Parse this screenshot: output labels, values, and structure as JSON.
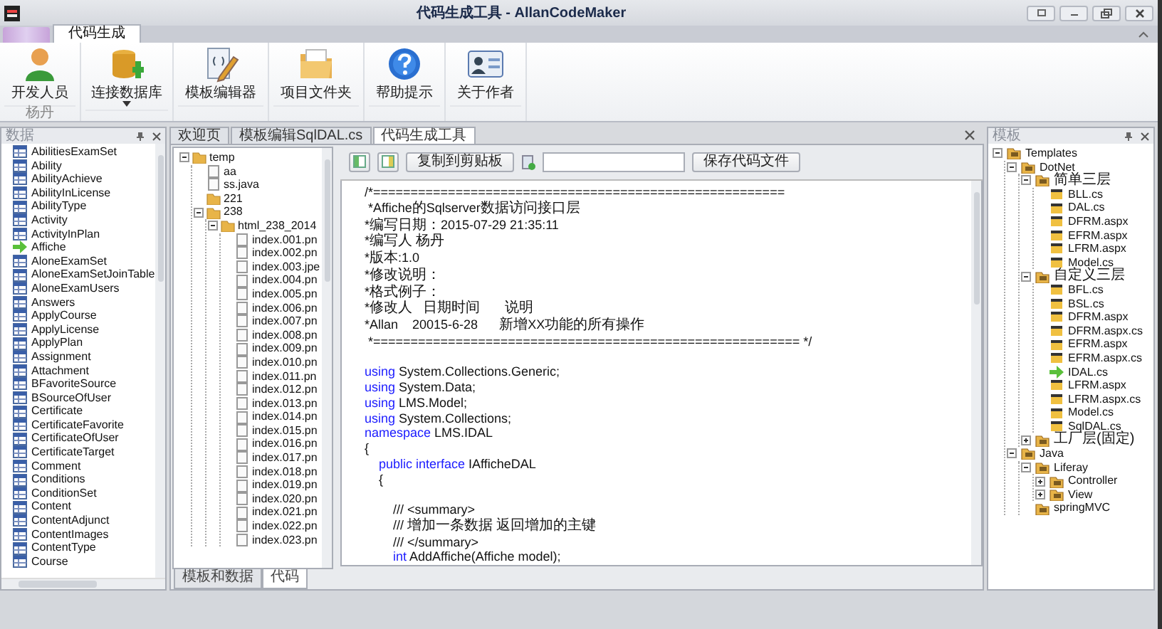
{
  "window": {
    "title": "代码生成工具 - AllanCodeMaker"
  },
  "ribbon": {
    "tabs": [
      {
        "label": "代码生成",
        "selected": true
      }
    ],
    "groups": [
      {
        "label": "杨丹",
        "buttons": [
          {
            "label": "开发人员",
            "dropdown": false
          }
        ]
      },
      {
        "buttons": [
          {
            "label": "连接数据库",
            "dropdown": true
          }
        ]
      },
      {
        "buttons": [
          {
            "label": "模板编辑器",
            "dropdown": false
          }
        ]
      },
      {
        "buttons": [
          {
            "label": "项目文件夹",
            "dropdown": false
          }
        ]
      },
      {
        "buttons": [
          {
            "label": "帮助提示",
            "dropdown": false
          }
        ]
      },
      {
        "buttons": [
          {
            "label": "关于作者",
            "dropdown": false
          }
        ]
      }
    ]
  },
  "data_panel": {
    "title": "数据",
    "items": [
      {
        "label": "AbilitiesExamSet",
        "kind": "table"
      },
      {
        "label": "Ability",
        "kind": "table"
      },
      {
        "label": "AbilityAchieve",
        "kind": "table"
      },
      {
        "label": "AbilityInLicense",
        "kind": "table"
      },
      {
        "label": "AbilityType",
        "kind": "table"
      },
      {
        "label": "Activity",
        "kind": "table"
      },
      {
        "label": "ActivityInPlan",
        "kind": "table"
      },
      {
        "label": "Affiche",
        "kind": "current"
      },
      {
        "label": "AloneExamSet",
        "kind": "table"
      },
      {
        "label": "AloneExamSetJoinTable",
        "kind": "table"
      },
      {
        "label": "AloneExamUsers",
        "kind": "table"
      },
      {
        "label": "Answers",
        "kind": "table"
      },
      {
        "label": "ApplyCourse",
        "kind": "table"
      },
      {
        "label": "ApplyLicense",
        "kind": "table"
      },
      {
        "label": "ApplyPlan",
        "kind": "table"
      },
      {
        "label": "Assignment",
        "kind": "table"
      },
      {
        "label": "Attachment",
        "kind": "table"
      },
      {
        "label": "BFavoriteSource",
        "kind": "table"
      },
      {
        "label": "BSourceOfUser",
        "kind": "table"
      },
      {
        "label": "Certificate",
        "kind": "table"
      },
      {
        "label": "CertificateFavorite",
        "kind": "table"
      },
      {
        "label": "CertificateOfUser",
        "kind": "table"
      },
      {
        "label": "CertificateTarget",
        "kind": "table"
      },
      {
        "label": "Comment",
        "kind": "table"
      },
      {
        "label": "Conditions",
        "kind": "table"
      },
      {
        "label": "ConditionSet",
        "kind": "table"
      },
      {
        "label": "Content",
        "kind": "table"
      },
      {
        "label": "ContentAdjunct",
        "kind": "table"
      },
      {
        "label": "ContentImages",
        "kind": "table"
      },
      {
        "label": "ContentType",
        "kind": "table"
      },
      {
        "label": "Course",
        "kind": "table"
      }
    ]
  },
  "documents": {
    "tabs": [
      {
        "label": "欢迎页",
        "selected": false
      },
      {
        "label": "模板编辑SqlDAL.cs",
        "selected": false
      },
      {
        "label": "代码生成工具",
        "selected": true
      }
    ]
  },
  "file_tree": {
    "nodes": [
      {
        "label": "temp",
        "kind": "folder",
        "expanded": true,
        "children": [
          {
            "label": "aa",
            "kind": "file"
          },
          {
            "label": "ss.java",
            "kind": "file"
          },
          {
            "label": "221",
            "kind": "folder"
          },
          {
            "label": "238",
            "kind": "folder",
            "expanded": true,
            "children": [
              {
                "label": "html_238_2014",
                "kind": "folder",
                "expanded": true,
                "children": [
                  {
                    "label": "index.001.pn",
                    "kind": "file"
                  },
                  {
                    "label": "index.002.pn",
                    "kind": "file"
                  },
                  {
                    "label": "index.003.jpe",
                    "kind": "file"
                  },
                  {
                    "label": "index.004.pn",
                    "kind": "file"
                  },
                  {
                    "label": "index.005.pn",
                    "kind": "file"
                  },
                  {
                    "label": "index.006.pn",
                    "kind": "file"
                  },
                  {
                    "label": "index.007.pn",
                    "kind": "file"
                  },
                  {
                    "label": "index.008.pn",
                    "kind": "file"
                  },
                  {
                    "label": "index.009.pn",
                    "kind": "file"
                  },
                  {
                    "label": "index.010.pn",
                    "kind": "file"
                  },
                  {
                    "label": "index.011.pn",
                    "kind": "file"
                  },
                  {
                    "label": "index.012.pn",
                    "kind": "file"
                  },
                  {
                    "label": "index.013.pn",
                    "kind": "file"
                  },
                  {
                    "label": "index.014.pn",
                    "kind": "file"
                  },
                  {
                    "label": "index.015.pn",
                    "kind": "file"
                  },
                  {
                    "label": "index.016.pn",
                    "kind": "file"
                  },
                  {
                    "label": "index.017.pn",
                    "kind": "file"
                  },
                  {
                    "label": "index.018.pn",
                    "kind": "file"
                  },
                  {
                    "label": "index.019.pn",
                    "kind": "file"
                  },
                  {
                    "label": "index.020.pn",
                    "kind": "file"
                  },
                  {
                    "label": "index.021.pn",
                    "kind": "file"
                  },
                  {
                    "label": "index.022.pn",
                    "kind": "file"
                  },
                  {
                    "label": "index.023.pn",
                    "kind": "file"
                  }
                ]
              }
            ]
          }
        ]
      }
    ],
    "tabs": [
      {
        "label": "模板和数据",
        "selected": false
      },
      {
        "label": "代码",
        "selected": true
      }
    ]
  },
  "code_toolbar": {
    "copy_button": "复制到剪贴板",
    "save_button": "保存代码文件"
  },
  "code": {
    "lines": [
      {
        "segments": [
          {
            "text": "/*=======================================================",
            "kind": "plain"
          }
        ]
      },
      {
        "segments": [
          {
            "text": " *Affiche的Sqlserver数据访问接口层",
            "kind": "plain"
          }
        ]
      },
      {
        "segments": [
          {
            "text": "*编写日期：2015-07-29 21:35:11",
            "kind": "plain"
          }
        ]
      },
      {
        "segments": [
          {
            "text": "*编写人 杨丹",
            "kind": "plain"
          }
        ]
      },
      {
        "segments": [
          {
            "text": "*版本:1.0",
            "kind": "plain"
          }
        ]
      },
      {
        "segments": [
          {
            "text": "*修改说明：",
            "kind": "plain"
          }
        ]
      },
      {
        "segments": [
          {
            "text": "*格式例子：",
            "kind": "plain"
          }
        ]
      },
      {
        "segments": [
          {
            "text": "*修改人   日期时间       说明",
            "kind": "plain"
          }
        ]
      },
      {
        "segments": [
          {
            "text": "*Allan    20015-6-28      新增XX功能的所有操作",
            "kind": "plain"
          }
        ]
      },
      {
        "segments": [
          {
            "text": " *========================================================= */",
            "kind": "plain"
          }
        ]
      },
      {
        "kind": "blank"
      },
      {
        "segments": [
          {
            "text": "using",
            "kind": "keyword"
          },
          {
            "text": " System.Collections.Generic;",
            "kind": "plain"
          }
        ]
      },
      {
        "segments": [
          {
            "text": "using",
            "kind": "keyword"
          },
          {
            "text": " System.Data;",
            "kind": "plain"
          }
        ]
      },
      {
        "segments": [
          {
            "text": "using",
            "kind": "keyword"
          },
          {
            "text": " LMS.Model;",
            "kind": "plain"
          }
        ]
      },
      {
        "segments": [
          {
            "text": "using",
            "kind": "keyword"
          },
          {
            "text": " System.Collections;",
            "kind": "plain"
          }
        ]
      },
      {
        "segments": [
          {
            "text": "namespace",
            "kind": "keyword"
          },
          {
            "text": " LMS.IDAL",
            "kind": "plain"
          }
        ]
      },
      {
        "segments": [
          {
            "text": "{",
            "kind": "plain"
          }
        ]
      },
      {
        "segments": [
          {
            "text": "    public interface",
            "kind": "keyword"
          },
          {
            "text": " IAfficheDAL",
            "kind": "plain"
          }
        ]
      },
      {
        "segments": [
          {
            "text": "    {",
            "kind": "plain"
          }
        ]
      },
      {
        "kind": "blank"
      },
      {
        "segments": [
          {
            "text": "        /// <summary>",
            "kind": "plain"
          }
        ]
      },
      {
        "segments": [
          {
            "text": "        /// 增加一条数据 返回增加的主键",
            "kind": "plain"
          }
        ]
      },
      {
        "segments": [
          {
            "text": "        /// </summary>",
            "kind": "plain"
          }
        ]
      },
      {
        "segments": [
          {
            "text": "        int",
            "kind": "keyword"
          },
          {
            "text": " AddAffiche(Affiche model);",
            "kind": "plain"
          }
        ]
      }
    ]
  },
  "template_panel": {
    "title": "模板",
    "nodes": [
      {
        "label": "Templates",
        "kind": "folder",
        "expanded": true,
        "children": [
          {
            "label": "DotNet",
            "kind": "folder",
            "expanded": true,
            "children": [
              {
                "label": "简单三层",
                "kind": "folder",
                "expanded": true,
                "children": [
                  {
                    "label": "BLL.cs",
                    "kind": "template"
                  },
                  {
                    "label": "DAL.cs",
                    "kind": "template"
                  },
                  {
                    "label": "DFRM.aspx",
                    "kind": "template"
                  },
                  {
                    "label": "EFRM.aspx",
                    "kind": "template"
                  },
                  {
                    "label": "LFRM.aspx",
                    "kind": "template"
                  },
                  {
                    "label": "Model.cs",
                    "kind": "template"
                  }
                ]
              },
              {
                "label": "自定义三层",
                "kind": "folder",
                "expanded": true,
                "children": [
                  {
                    "label": "BFL.cs",
                    "kind": "template"
                  },
                  {
                    "label": "BSL.cs",
                    "kind": "template"
                  },
                  {
                    "label": "DFRM.aspx",
                    "kind": "template"
                  },
                  {
                    "label": "DFRM.aspx.cs",
                    "kind": "template"
                  },
                  {
                    "label": "EFRM.aspx",
                    "kind": "template"
                  },
                  {
                    "label": "EFRM.aspx.cs",
                    "kind": "template"
                  },
                  {
                    "label": "IDAL.cs",
                    "kind": "current"
                  },
                  {
                    "label": "LFRM.aspx",
                    "kind": "template"
                  },
                  {
                    "label": "LFRM.aspx.cs",
                    "kind": "template"
                  },
                  {
                    "label": "Model.cs",
                    "kind": "template"
                  },
                  {
                    "label": "SqlDAL.cs",
                    "kind": "template"
                  }
                ]
              },
              {
                "label": "工厂层(固定)",
                "kind": "folder",
                "expanded": false
              }
            ]
          },
          {
            "label": "Java",
            "kind": "folder",
            "expanded": true,
            "children": [
              {
                "label": "Liferay",
                "kind": "folder",
                "expanded": true,
                "children": [
                  {
                    "label": "Controller",
                    "kind": "folder",
                    "expanded": false
                  },
                  {
                    "label": "View",
                    "kind": "folder",
                    "expanded": false
                  }
                ]
              },
              {
                "label": "springMVC",
                "kind": "folder"
              }
            ]
          }
        ]
      }
    ]
  }
}
